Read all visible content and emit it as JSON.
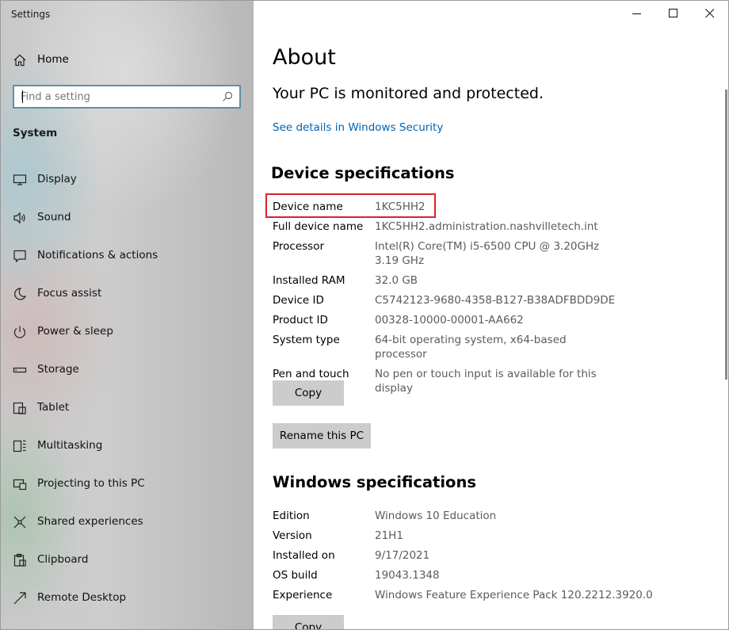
{
  "window": {
    "title": "Settings"
  },
  "sidebar": {
    "home_label": "Home",
    "search_placeholder": "Find a setting",
    "section_label": "System",
    "items": [
      {
        "label": "Display",
        "icon": "display-icon"
      },
      {
        "label": "Sound",
        "icon": "sound-icon"
      },
      {
        "label": "Notifications & actions",
        "icon": "notifications-icon"
      },
      {
        "label": "Focus assist",
        "icon": "focus-assist-icon"
      },
      {
        "label": "Power & sleep",
        "icon": "power-icon"
      },
      {
        "label": "Storage",
        "icon": "storage-icon"
      },
      {
        "label": "Tablet",
        "icon": "tablet-icon"
      },
      {
        "label": "Multitasking",
        "icon": "multitasking-icon"
      },
      {
        "label": "Projecting to this PC",
        "icon": "projecting-icon"
      },
      {
        "label": "Shared experiences",
        "icon": "shared-experiences-icon"
      },
      {
        "label": "Clipboard",
        "icon": "clipboard-icon"
      },
      {
        "label": "Remote Desktop",
        "icon": "remote-desktop-icon"
      }
    ]
  },
  "main": {
    "title": "About",
    "status_message": "Your PC is monitored and protected.",
    "security_link": "See details in Windows Security",
    "device_specs": {
      "heading": "Device specifications",
      "rows": [
        {
          "key": "Device name",
          "value": "1KC5HH2"
        },
        {
          "key": "Full device name",
          "value": "1KC5HH2.administration.nashvilletech.int"
        },
        {
          "key": "Processor",
          "value": "Intel(R) Core(TM) i5-6500 CPU @ 3.20GHz   3.19 GHz"
        },
        {
          "key": "Installed RAM",
          "value": "32.0 GB"
        },
        {
          "key": "Device ID",
          "value": "C5742123-9680-4358-B127-B38ADFBDD9DE"
        },
        {
          "key": "Product ID",
          "value": "00328-10000-00001-AA662"
        },
        {
          "key": "System type",
          "value": "64-bit operating system, x64-based processor"
        },
        {
          "key": "Pen and touch",
          "value": "No pen or touch input is available for this display"
        }
      ],
      "copy_label": "Copy",
      "rename_label": "Rename this PC"
    },
    "windows_specs": {
      "heading": "Windows specifications",
      "rows": [
        {
          "key": "Edition",
          "value": "Windows 10 Education"
        },
        {
          "key": "Version",
          "value": "21H1"
        },
        {
          "key": "Installed on",
          "value": "9/17/2021"
        },
        {
          "key": "OS build",
          "value": "19043.1348"
        },
        {
          "key": "Experience",
          "value": "Windows Feature Experience Pack 120.2212.3920.0"
        }
      ],
      "copy_label": "Copy"
    }
  },
  "colors": {
    "link": "#0063b1",
    "highlight": "#e01e2a",
    "button": "#cccccc"
  }
}
